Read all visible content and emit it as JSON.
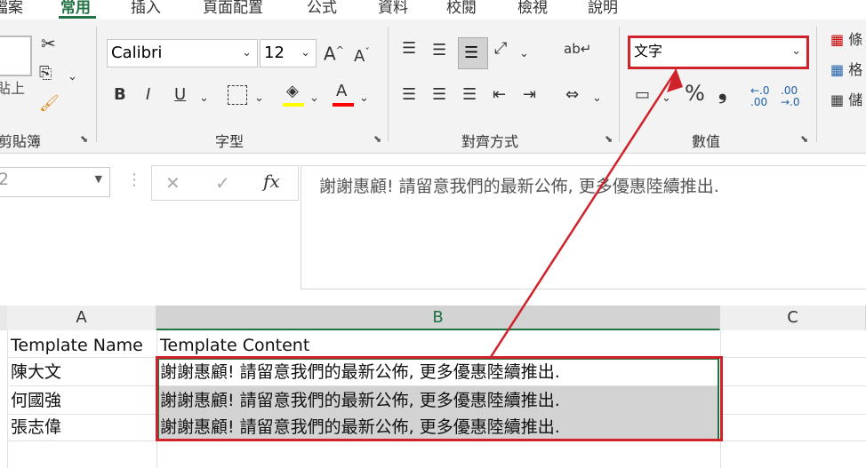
{
  "tabs": [
    "檔案",
    "常用",
    "插入",
    "頁面配置",
    "公式",
    "資料",
    "校閱",
    "檢視",
    "說明"
  ],
  "ribbon": {
    "clipboard": {
      "label": "剪貼簿",
      "paste_label": "貼上"
    },
    "font": {
      "label": "字型",
      "font_name": "Calibri",
      "font_size": "12",
      "bold": "B",
      "italic": "I",
      "underline": "U",
      "grow": "A^",
      "shrink": "Aˇ",
      "font_color": "A"
    },
    "alignment": {
      "label": "對齊方式"
    },
    "number": {
      "label": "數值",
      "format": "文字",
      "percent": "%",
      "comma": "❟",
      "inc_decimal": "←.0 .00",
      "dec_decimal": ".00 →.0"
    },
    "styles": {
      "items": [
        "條",
        "格",
        "儲"
      ]
    }
  },
  "formula_bar": {
    "name_box": "2",
    "cancel": "✕",
    "enter": "✓",
    "fx": "fx",
    "content": "謝謝惠顧! 請留意我們的最新公佈, 更多優惠陸續推出."
  },
  "columns": [
    "A",
    "B",
    "C"
  ],
  "rows": [
    {
      "a": "Template Name",
      "b": "Template Content"
    },
    {
      "a": "陳大文",
      "b": "謝謝惠顧! 請留意我們的最新公佈, 更多優惠陸續推出."
    },
    {
      "a": "何國強",
      "b": "謝謝惠顧! 請留意我們的最新公佈, 更多優惠陸續推出."
    },
    {
      "a": "張志偉",
      "b": "謝謝惠顧! 請留意我們的最新公佈, 更多優惠陸續推出."
    }
  ],
  "colors": {
    "accent": "#217346",
    "annotation": "#d0222b"
  }
}
